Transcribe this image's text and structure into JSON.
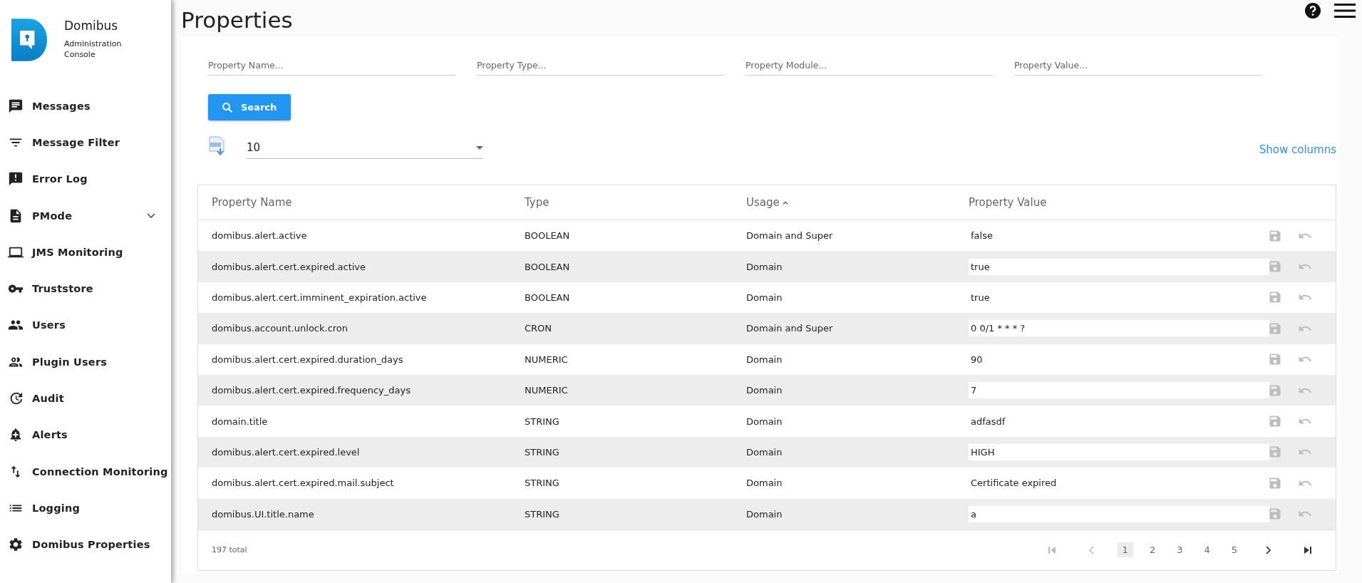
{
  "app": {
    "name": "Domibus",
    "subtitle": "Administration Console"
  },
  "sidebar": {
    "items": [
      {
        "label": "Messages"
      },
      {
        "label": "Message Filter"
      },
      {
        "label": "Error Log"
      },
      {
        "label": "PMode",
        "expanded": false
      },
      {
        "label": "JMS Monitoring"
      },
      {
        "label": "Truststore"
      },
      {
        "label": "Users"
      },
      {
        "label": "Plugin Users"
      },
      {
        "label": "Audit"
      },
      {
        "label": "Alerts"
      },
      {
        "label": "Connection Monitoring"
      },
      {
        "label": "Logging"
      },
      {
        "label": "Domibus Properties"
      }
    ]
  },
  "page": {
    "title": "Properties"
  },
  "filters": [
    {
      "placeholder": "Property Name..."
    },
    {
      "placeholder": "Property Type..."
    },
    {
      "placeholder": "Property Module..."
    },
    {
      "placeholder": "Property Value..."
    }
  ],
  "search_button": "Search",
  "page_size": {
    "value": "10"
  },
  "show_columns": "Show columns",
  "table": {
    "columns": [
      {
        "label": "Property Name",
        "sorted": false
      },
      {
        "label": "Type",
        "sorted": false
      },
      {
        "label": "Usage",
        "sorted": true
      },
      {
        "label": "Property Value",
        "sorted": false
      }
    ],
    "rows": [
      {
        "name": "domibus.alert.active",
        "type": "BOOLEAN",
        "usage": "Domain and Super",
        "value": "false"
      },
      {
        "name": "domibus.alert.cert.expired.active",
        "type": "BOOLEAN",
        "usage": "Domain",
        "value": "true"
      },
      {
        "name": "domibus.alert.cert.imminent_expiration.active",
        "type": "BOOLEAN",
        "usage": "Domain",
        "value": "true"
      },
      {
        "name": "domibus.account.unlock.cron",
        "type": "CRON",
        "usage": "Domain and Super",
        "value": "0 0/1 * * * ?"
      },
      {
        "name": "domibus.alert.cert.expired.duration_days",
        "type": "NUMERIC",
        "usage": "Domain",
        "value": "90"
      },
      {
        "name": "domibus.alert.cert.expired.frequency_days",
        "type": "NUMERIC",
        "usage": "Domain",
        "value": "7"
      },
      {
        "name": "domain.title",
        "type": "STRING",
        "usage": "Domain",
        "value": "adfasdf"
      },
      {
        "name": "domibus.alert.cert.expired.level",
        "type": "STRING",
        "usage": "Domain",
        "value": "HIGH"
      },
      {
        "name": "domibus.alert.cert.expired.mail.subject",
        "type": "STRING",
        "usage": "Domain",
        "value": "Certificate expired"
      },
      {
        "name": "domibus.UI.title.name",
        "type": "STRING",
        "usage": "Domain",
        "value": "a"
      }
    ]
  },
  "footer": {
    "total": "197 total"
  },
  "pager": {
    "first_disabled": true,
    "prev_disabled": true,
    "pages": [
      {
        "label": "1",
        "selected": true
      },
      {
        "label": "2",
        "selected": false
      },
      {
        "label": "3",
        "selected": false
      },
      {
        "label": "4",
        "selected": false
      },
      {
        "label": "5",
        "selected": false
      }
    ],
    "next_disabled": false,
    "last_disabled": false
  }
}
